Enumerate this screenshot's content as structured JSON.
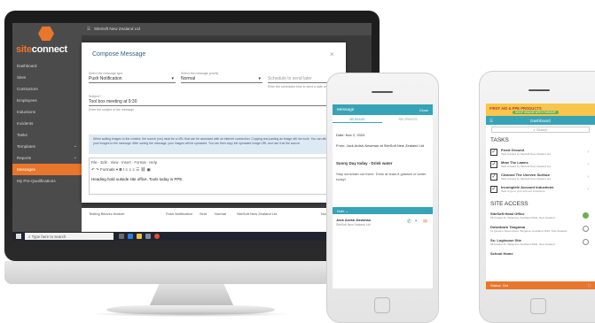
{
  "desktop": {
    "app_logo": {
      "part1": "site",
      "part2": "connect"
    },
    "sidebar": {
      "items": [
        {
          "label": "Dashboard"
        },
        {
          "label": "Sites"
        },
        {
          "label": "Contractors"
        },
        {
          "label": "Employees"
        },
        {
          "label": "Inductions"
        },
        {
          "label": "Incidents"
        },
        {
          "label": "Tasks"
        },
        {
          "label": "Templates"
        },
        {
          "label": "Reports"
        },
        {
          "label": "Messages"
        },
        {
          "label": "My Pre-Qualifications"
        }
      ],
      "active_index": 9
    },
    "topbar": {
      "company": "SiteSoft New Zealand Ltd"
    },
    "modal": {
      "title": "Compose Message",
      "message_type_label": "Select the message type",
      "message_type": "Push Notification",
      "priority_label": "Select the message priority",
      "priority": "Normal",
      "schedule_placeholder": "Schedule to send later",
      "schedule_hint": "Enter the scheduled time to send a date and time",
      "subject_label": "Subject *",
      "subject": "Tool box meeting at 9:30",
      "subject_hint": "Enter the subject of the message",
      "info_text": "When adding images to the content, the source (src) must be a URL that can be accessed with an internet connection. Copying and pasting an image will not work. You can attach your images to the message. After saving the message, your images will be uploaded. You can then copy the uploaded image URL and use it as the source.",
      "editor_menu": [
        "File",
        "Edit",
        "View",
        "Insert",
        "Format",
        "Help"
      ],
      "editor_formats": "Formats",
      "editor_text": "Heading hold outside site office. Tools today is PPE."
    },
    "background_row": {
      "name": "Testing Bitovec feature",
      "type": "Push Notification",
      "status": "Sent",
      "priority": "Normal",
      "sender": "SiteSoft New Zealand Ltd",
      "date": "Nov 2, 2020"
    },
    "taskbar": {
      "search_placeholder": "Type here to search"
    }
  },
  "phone1": {
    "header": {
      "title": "Message",
      "action": "Close"
    },
    "tabs": [
      "MESSAGE",
      "RECIPIENTS"
    ],
    "date": "Date: Nov 2, 2020",
    "from": "From: Jack Ardsh-Newman at SiteSoft New Zealand Ltd",
    "subject": "Sunny Day today - Drink water",
    "body": "Stay sunsmart out there. Drink at least 8 glasses of water today!",
    "note_label": "Note",
    "contact_name": "Jack Ardsh-Newman",
    "contact_company": "SiteSoft New Zealand Ltd"
  },
  "phone2": {
    "banner": {
      "title": "FIRST AID & PPE PRODUCTS",
      "cta": "SHOP ONLINE WITH FUSIONP"
    },
    "header": "Dashboard",
    "search_placeholder": "Search",
    "tasks_title": "TASKS",
    "tasks": [
      {
        "title": "Fixed Ground",
        "subtitle": "Task created by SiteSoft New Zealand Ltd"
      },
      {
        "title": "Mow The Lawns",
        "subtitle": "Task created by SiteSoft New Zealand Ltd"
      },
      {
        "title": "Cleaned The Uneven Surface",
        "subtitle": "Task created by SiteSoft New Zealand Ltd"
      },
      {
        "title": "Incomplete Account Inductions",
        "subtitle": "Task to go to your account inductions"
      }
    ],
    "site_access_title": "SITE ACCESS",
    "sites": [
      {
        "title": "SiteSoft Head Office",
        "subtitle": "58 Karaka St, Takapuna, Auckland 0622, New Zealand",
        "selected": true
      },
      {
        "title": "Downtown Tangaroa",
        "subtitle": "12 Queens Street Road, Tangaroa, Auckland 1010, New Zealand",
        "selected": false
      },
      {
        "title": "Ss: Loghouse Site",
        "subtitle": "58 Karaka St, Takapuna, Auckland 0622, New Zealand",
        "selected": false
      },
      {
        "title": "School Home",
        "subtitle": "",
        "selected": false
      }
    ],
    "status_bar": "Status: Out"
  },
  "colors": {
    "brand_orange": "#e8762c",
    "teal": "#37a3b6",
    "sidebar_gray": "#4b4b4b"
  }
}
